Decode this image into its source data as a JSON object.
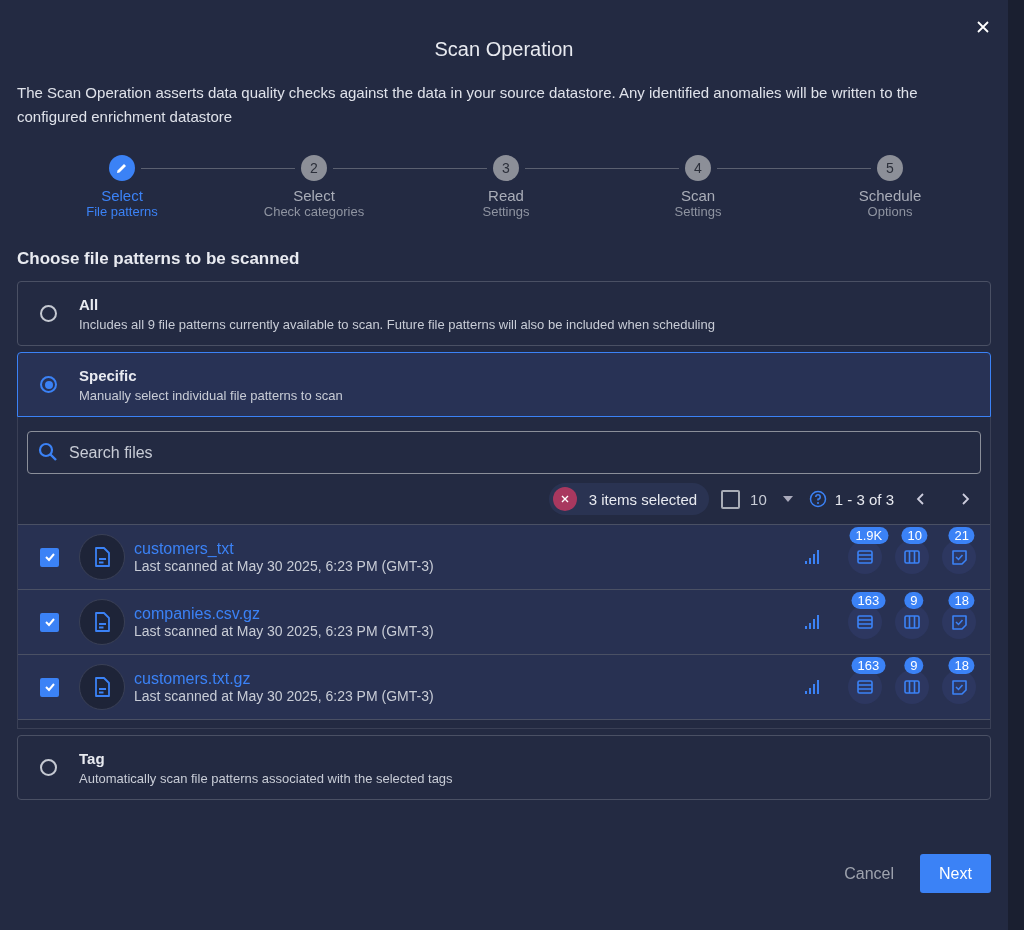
{
  "dialog": {
    "title": "Scan Operation",
    "description": "The Scan Operation asserts data quality checks against the data in your source datastore. Any identified anomalies will be written to the configured enrichment datastore"
  },
  "steps": [
    {
      "label": "Select",
      "sublabel": "File patterns",
      "selected": true
    },
    {
      "number": "2",
      "label": "Select",
      "sublabel": "Check categories",
      "selected": false
    },
    {
      "number": "3",
      "label": "Read",
      "sublabel": "Settings",
      "selected": false
    },
    {
      "number": "4",
      "label": "Scan",
      "sublabel": "Settings",
      "selected": false
    },
    {
      "number": "5",
      "label": "Schedule",
      "sublabel": "Options",
      "selected": false
    }
  ],
  "section_title": "Choose file patterns to be scanned",
  "options": [
    {
      "label": "All",
      "description": "Includes all 9 file patterns currently available to scan. Future file patterns will also be included when scheduling",
      "selected": false
    },
    {
      "label": "Specific",
      "description": "Manually select individual file patterns to scan",
      "selected": true,
      "file_list": {
        "search": {
          "placeholder": "Search files"
        },
        "selection_chip": "3 items selected",
        "select_all_checked": false,
        "rows_per_page": "10",
        "range": "1 - 3 of 3",
        "files": [
          {
            "name": "customers_txt",
            "subtitle": "Last scanned at May 30 2025, 6:23 PM (GMT-3)",
            "checked": true,
            "records": "1.9K",
            "fields": "10",
            "checks": "21"
          },
          {
            "name": "companies.csv.gz",
            "subtitle": "Last scanned at May 30 2025, 6:23 PM (GMT-3)",
            "checked": true,
            "records": "163",
            "fields": "9",
            "checks": "18"
          },
          {
            "name": "customers.txt.gz",
            "subtitle": "Last scanned at May 30 2025, 6:23 PM (GMT-3)",
            "checked": true,
            "records": "163",
            "fields": "9",
            "checks": "18"
          }
        ]
      }
    },
    {
      "label": "Tag",
      "description": "Automatically scan file patterns associated with the selected tags",
      "selected": false
    }
  ],
  "buttons": {
    "cancel": "Cancel",
    "next": "Next"
  }
}
